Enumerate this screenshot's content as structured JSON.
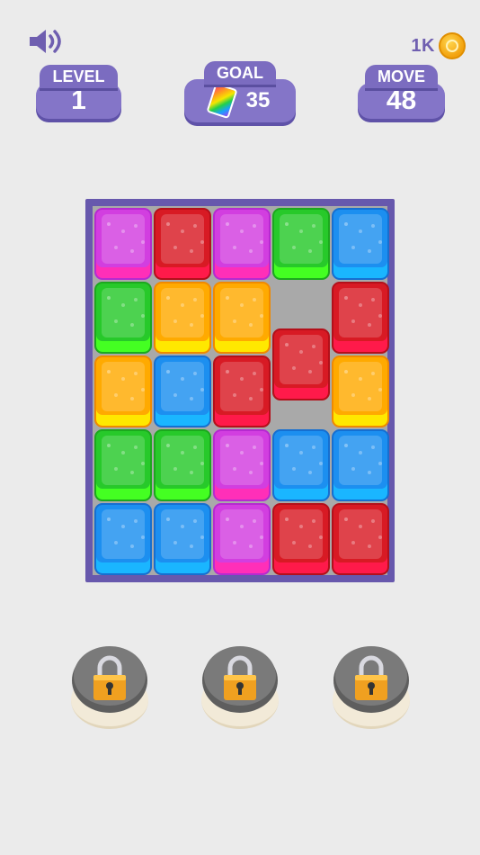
{
  "header": {
    "sound_icon": "speaker-icon",
    "coins": {
      "amount": "1K",
      "icon": "coin-icon"
    }
  },
  "stats": {
    "level": {
      "label": "LEVEL",
      "value": "1"
    },
    "goal": {
      "label": "GOAL",
      "value": "35",
      "icon": "rainbow-block-icon"
    },
    "move": {
      "label": "MOVE",
      "value": "48"
    }
  },
  "board": {
    "columns": 5,
    "rows": 5,
    "blocks": [
      [
        "purple",
        "red",
        "purple",
        "green",
        "blue"
      ],
      [
        "green",
        "orange",
        "orange",
        "empty",
        "red"
      ],
      [
        "orange",
        "blue",
        "red",
        "red",
        "orange"
      ],
      [
        "green",
        "green",
        "purple",
        "blue",
        "blue"
      ],
      [
        "blue",
        "blue",
        "purple",
        "red",
        "red"
      ]
    ],
    "colors": {
      "purple": "#d23ee0",
      "red": "#d81a24",
      "green": "#27c92a",
      "blue": "#1c8ff0",
      "orange": "#ffaa00",
      "frame": "#6758ad"
    }
  },
  "slots": [
    {
      "state": "locked",
      "icon": "padlock-icon"
    },
    {
      "state": "locked",
      "icon": "padlock-icon"
    },
    {
      "state": "locked",
      "icon": "padlock-icon"
    }
  ]
}
